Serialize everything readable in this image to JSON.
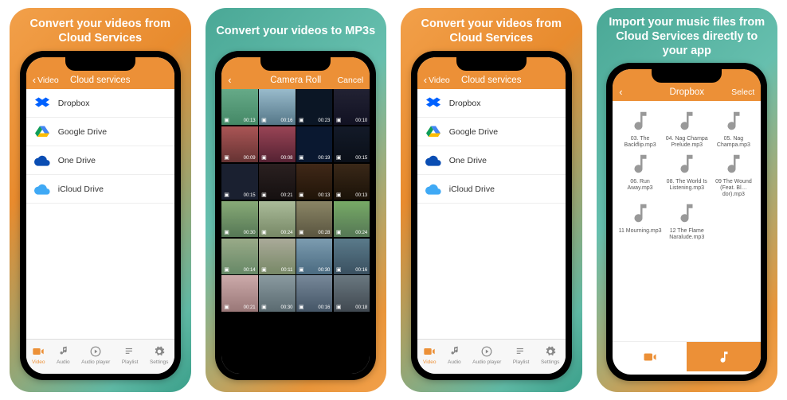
{
  "screenshots": [
    {
      "caption": "Convert your videos from Cloud Services",
      "nav": {
        "back": "Video",
        "title": "Cloud services"
      },
      "services": [
        {
          "key": "dropbox",
          "label": "Dropbox"
        },
        {
          "key": "gdrive",
          "label": "Google Drive"
        },
        {
          "key": "onedrive",
          "label": "One Drive"
        },
        {
          "key": "icloud",
          "label": "iCloud Drive"
        }
      ],
      "tabs": [
        {
          "key": "video",
          "label": "Video",
          "active": true
        },
        {
          "key": "audio",
          "label": "Audio"
        },
        {
          "key": "player",
          "label": "Audio player"
        },
        {
          "key": "playlist",
          "label": "Playlist"
        },
        {
          "key": "settings",
          "label": "Settings"
        }
      ]
    },
    {
      "caption": "Convert your videos to MP3s",
      "nav": {
        "back": "",
        "title": "Camera Roll",
        "right": "Cancel"
      },
      "thumbs": [
        {
          "d": "00:13"
        },
        {
          "d": "00:16"
        },
        {
          "d": "00:23"
        },
        {
          "d": "00:10"
        },
        {
          "d": "00:09"
        },
        {
          "d": "00:08"
        },
        {
          "d": "00:19"
        },
        {
          "d": "00:15"
        },
        {
          "d": "00:15"
        },
        {
          "d": "00:21"
        },
        {
          "d": "00:13"
        },
        {
          "d": "00:13"
        },
        {
          "d": "00:30"
        },
        {
          "d": "00:24"
        },
        {
          "d": "00:28"
        },
        {
          "d": "00:24"
        },
        {
          "d": "00:14"
        },
        {
          "d": "00:11"
        },
        {
          "d": "00:30"
        },
        {
          "d": "00:16"
        },
        {
          "d": "00:21"
        },
        {
          "d": "00:30"
        },
        {
          "d": "00:16"
        },
        {
          "d": "00:18"
        }
      ]
    },
    {
      "caption": "Convert your videos from Cloud Services",
      "nav": {
        "back": "Video",
        "title": "Cloud services"
      },
      "services": [
        {
          "key": "dropbox",
          "label": "Dropbox"
        },
        {
          "key": "gdrive",
          "label": "Google Drive"
        },
        {
          "key": "onedrive",
          "label": "One Drive"
        },
        {
          "key": "icloud",
          "label": "iCloud Drive"
        }
      ],
      "tabs": [
        {
          "key": "video",
          "label": "Video",
          "active": true
        },
        {
          "key": "audio",
          "label": "Audio"
        },
        {
          "key": "player",
          "label": "Audio player"
        },
        {
          "key": "playlist",
          "label": "Playlist"
        },
        {
          "key": "settings",
          "label": "Settings"
        }
      ]
    },
    {
      "caption": "Import your music files from Cloud Services directly to your app",
      "nav": {
        "back": "",
        "title": "Dropbox",
        "right": "Select"
      },
      "music": [
        {
          "label": "03. The Backflip.mp3"
        },
        {
          "label": "04. Nag Champa Prelude.mp3"
        },
        {
          "label": "05. Nag Champa.mp3"
        },
        {
          "label": "06. Run Away.mp3"
        },
        {
          "label": "08. The World Is Listening.mp3"
        },
        {
          "label": "09 The Wound (Feat. Bl…dor).mp3"
        },
        {
          "label": "11 Mourning.mp3"
        },
        {
          "label": "12 The Flame Naralude.mp3"
        }
      ]
    }
  ]
}
